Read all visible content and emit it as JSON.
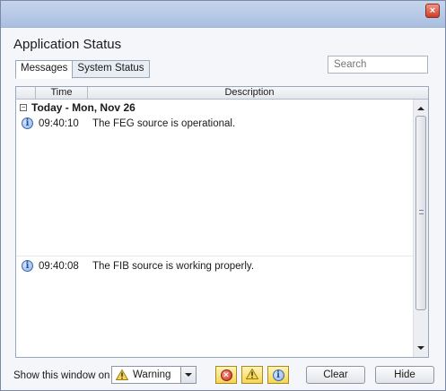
{
  "window": {
    "close_glyph": "×"
  },
  "app_title": "Application Status",
  "tabs": [
    {
      "label": "Messages",
      "active": true
    },
    {
      "label": "System Status",
      "active": false
    }
  ],
  "search": {
    "placeholder": "Search",
    "value": ""
  },
  "grid": {
    "columns": {
      "time": "Time",
      "description": "Description"
    },
    "group": {
      "label": "Today - Mon, Nov 26",
      "collapse_glyph": "−"
    },
    "rows": [
      {
        "icon": "info-icon",
        "time": "09:40:10",
        "description": "The FEG source is operational."
      },
      {
        "icon": "info-icon",
        "time": "09:40:08",
        "description": "The FIB source is working properly."
      }
    ]
  },
  "footer": {
    "label": "Show this window on",
    "combo_value": "Warning",
    "buttons": {
      "clear": "Clear",
      "hide": "Hide"
    }
  },
  "colors": {
    "accent": "#aabfe0",
    "warning": "#f5d654",
    "error": "#c9271b",
    "info": "#3c68b0"
  }
}
